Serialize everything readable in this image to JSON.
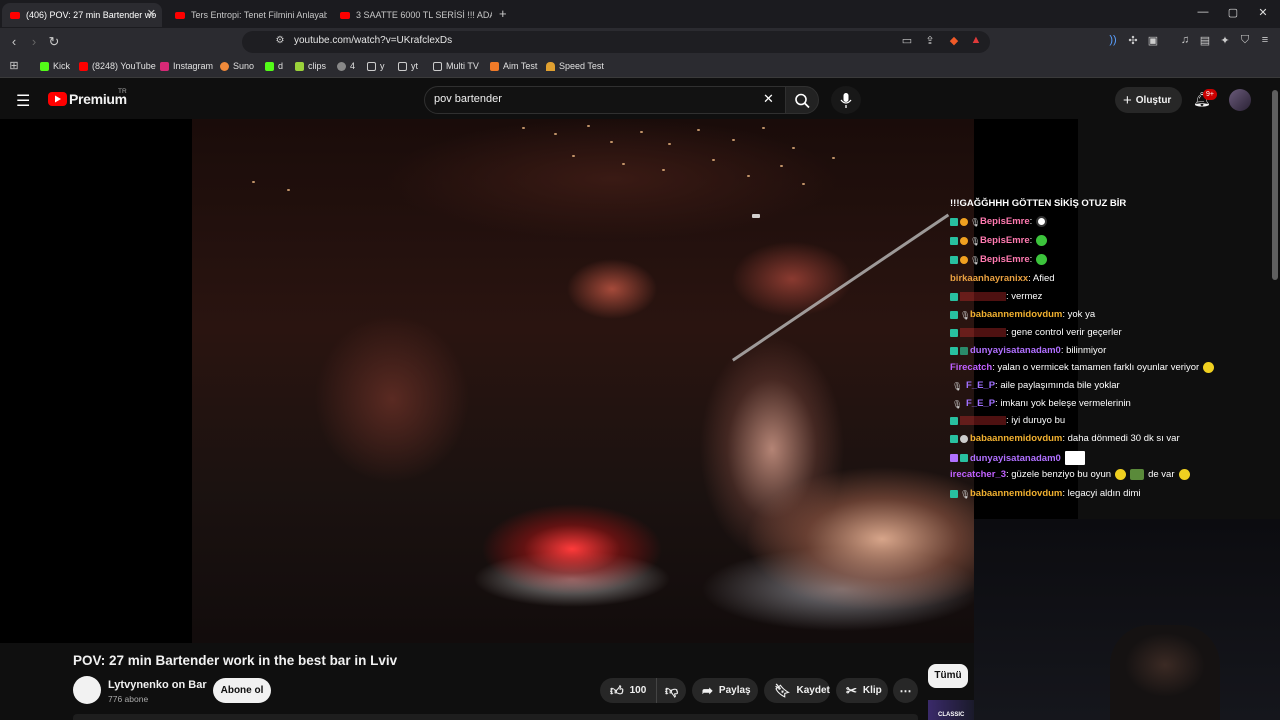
{
  "browser": {
    "tabs": [
      {
        "label": "(406) POV: 27 min Bartender wo",
        "active": true
      },
      {
        "label": "Ters Entropi: Tenet Filmini Anlayabild",
        "active": false
      },
      {
        "label": "3 SAATTE 6000 TL SERİSİ !!! ADANA",
        "active": false
      }
    ],
    "new_tab": "+",
    "url": "youtube.com/watch?v=UKrafclexDs",
    "bookmarks": [
      {
        "label": "Kick",
        "color": "#53fc18"
      },
      {
        "label": "(8248) YouTube",
        "color": "#ff0000"
      },
      {
        "label": "Instagram",
        "color": "#d62976"
      },
      {
        "label": "Suno",
        "color": "#f08a3a"
      },
      {
        "label": "d",
        "color": "#53fc18"
      },
      {
        "label": "clips",
        "color": "#9ad23a"
      },
      {
        "label": "4",
        "color": "#888888"
      },
      {
        "label": "y",
        "color": "#888888"
      },
      {
        "label": "yt",
        "color": "#888888"
      },
      {
        "label": "Multi TV",
        "color": "#888888"
      },
      {
        "label": "Aim Test",
        "color": "#f07a28"
      },
      {
        "label": "Speed Test",
        "color": "#e0a030"
      }
    ]
  },
  "youtube": {
    "logo": "Premium",
    "logo_region": "TR",
    "search_value": "pov bartender",
    "create_label": "Oluştur",
    "notification_badge": "9+",
    "accent": "#ff0000"
  },
  "chat": {
    "header": "!!!GAĞĞHHH GÖTTEN SİKİŞ OTUZ BİR",
    "messages": [
      {
        "user": "BepisEmre",
        "text": "",
        "color": "#ff7ab0",
        "emote": "#ffffff"
      },
      {
        "user": "BepisEmre",
        "text": "",
        "color": "#ff7ab0",
        "emote": "#3cc43c"
      },
      {
        "user": "BepisEmre",
        "text": "",
        "color": "#ff7ab0",
        "emote": "#3cc43c"
      },
      {
        "user": "birkaanhayranixx",
        "text": ": Afied",
        "color": "#e8a040",
        "emote": ""
      },
      {
        "user": "",
        "text": ": vermez",
        "color": "#e03030",
        "emote": ""
      },
      {
        "user": "babaannemidovdum",
        "text": ": yok ya",
        "color": "#f0b030",
        "emote": ""
      },
      {
        "user": "",
        "text": ": gene control verir geçerler",
        "color": "#e03030",
        "emote": ""
      },
      {
        "user": "dunyayisatanadam0",
        "text": ": bilinmiyor",
        "color": "#b070ff",
        "emote": ""
      },
      {
        "user": "Firecatch",
        "text": ": yalan o vermicek tamamen farklı oyunlar veriyor",
        "color": "#c060ff",
        "emote": "#f0d020"
      },
      {
        "user": "F_E_P",
        "text": ": aile paylaşımında bile yoklar",
        "color": "#a070ff",
        "emote": ""
      },
      {
        "user": "F_E_P",
        "text": ": imkanı yok beleşe vermelerinin",
        "color": "#a070ff",
        "emote": ""
      },
      {
        "user": "",
        "text": ": iyi duruyo bu",
        "color": "#e03030",
        "emote": ""
      },
      {
        "user": "babaannemidovdum",
        "text": ": daha dönmedi 30 dk sı var",
        "color": "#f0b030",
        "emote": ""
      },
      {
        "user": "dunyayisatanadam0",
        "text": "",
        "color": "#b070ff",
        "emote": "#ffffff"
      },
      {
        "user": "irecatcher_3",
        "text": ": güzele benziyo bu oyun",
        "color": "#c060ff",
        "emote": "#f0d020"
      },
      {
        "user": "babaannemidovdum",
        "text": ": legacyi aldın dimi",
        "color": "#f0b030",
        "emote": ""
      }
    ],
    "extra_text": "de var"
  },
  "video": {
    "title": "POV: 27 min Bartender work in the best bar in Lviv",
    "channel": "Lytvynenko on Bar",
    "subscribers": "776 abone",
    "subscribe_label": "Abone ol",
    "like_count": "100",
    "share_label": "Paylaş",
    "save_label": "Kaydet",
    "clip_label": "Klip",
    "all_label": "Tümü"
  }
}
